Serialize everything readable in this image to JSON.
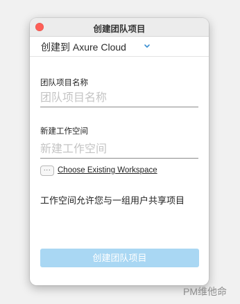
{
  "window": {
    "title": "创建团队项目"
  },
  "server": {
    "selected": "创建到 Axure Cloud",
    "chevron_icon": "chevron-down-icon",
    "chevron_color": "#3a8fd1"
  },
  "project_name": {
    "label": "团队项目名称",
    "placeholder": "团队项目名称",
    "value": ""
  },
  "workspace": {
    "label": "新建工作空间",
    "placeholder": "新建工作空间",
    "value": "",
    "browse_button": "···",
    "choose_existing": "Choose Existing Workspace"
  },
  "info_text": "工作空间允许您与一组用户共享项目",
  "submit": {
    "label": "创建团队项目",
    "color": "#a9d7f3",
    "enabled": false
  },
  "watermark": "PM维他命",
  "colors": {
    "close": "#fe5f57",
    "background": "#f1f1f1"
  }
}
